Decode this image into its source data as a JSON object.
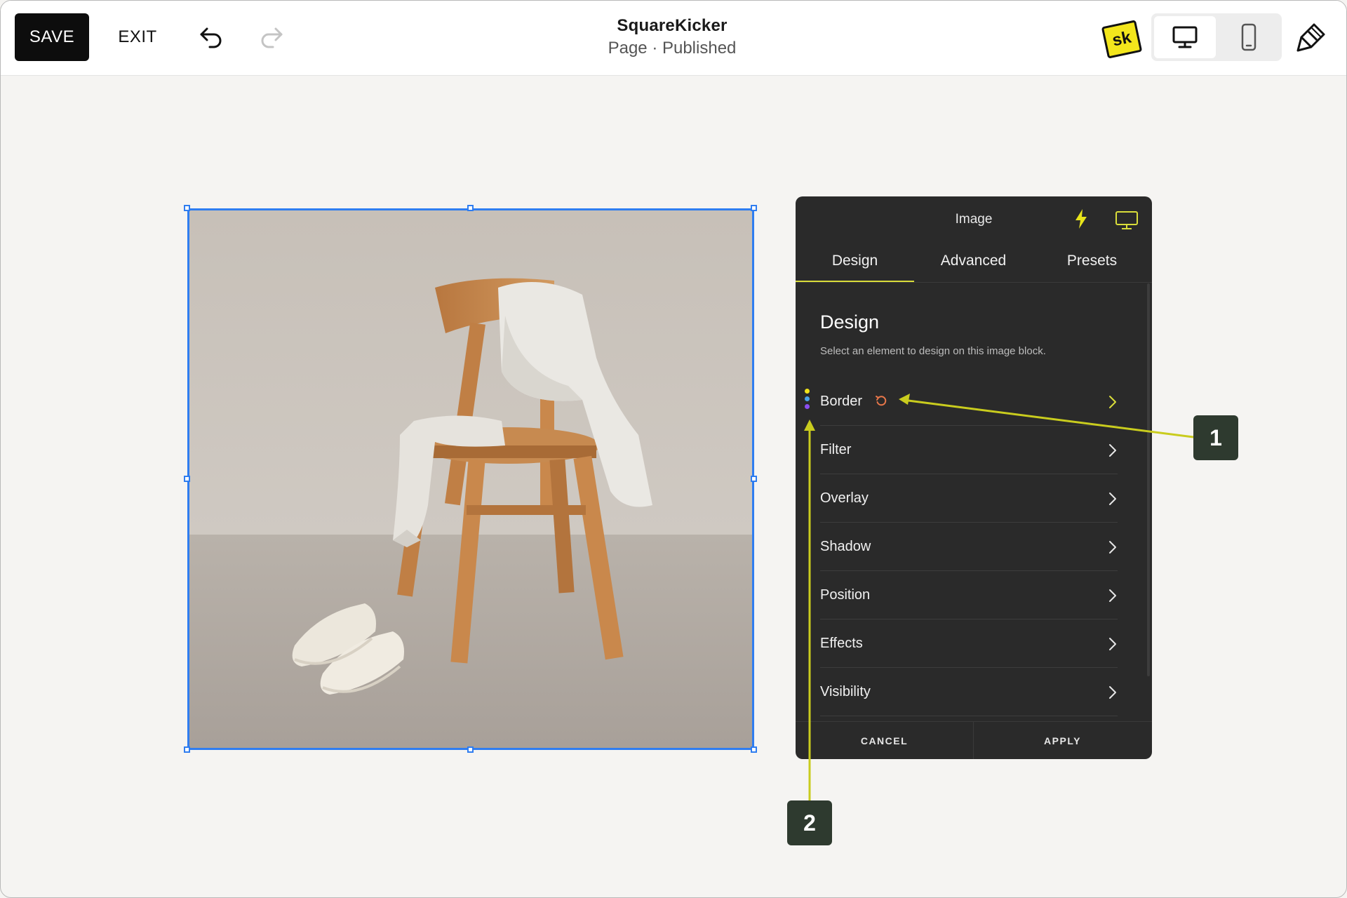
{
  "toolbar": {
    "save_label": "SAVE",
    "exit_label": "EXIT",
    "site_title": "SquareKicker",
    "page_status": "Page · Published",
    "logo_text": "sk"
  },
  "panel": {
    "title": "Image",
    "tabs": [
      {
        "label": "Design",
        "active": true
      },
      {
        "label": "Advanced",
        "active": false
      },
      {
        "label": "Presets",
        "active": false
      }
    ],
    "heading": "Design",
    "subtitle": "Select an element to design on this image block.",
    "items": [
      {
        "label": "Border",
        "has_reset": true
      },
      {
        "label": "Filter"
      },
      {
        "label": "Overlay"
      },
      {
        "label": "Shadow"
      },
      {
        "label": "Position"
      },
      {
        "label": "Effects"
      },
      {
        "label": "Visibility"
      }
    ],
    "cancel_label": "CANCEL",
    "apply_label": "APPLY",
    "dot_colors": [
      "#f0e21a",
      "#4aa3e8",
      "#8a4ef0"
    ]
  },
  "annotations": [
    {
      "label": "1"
    },
    {
      "label": "2"
    }
  ],
  "colors": {
    "selection": "#2f7df0",
    "accent": "#d9dd3a",
    "reset": "#e8774a",
    "callout": "#2e3a2f"
  }
}
